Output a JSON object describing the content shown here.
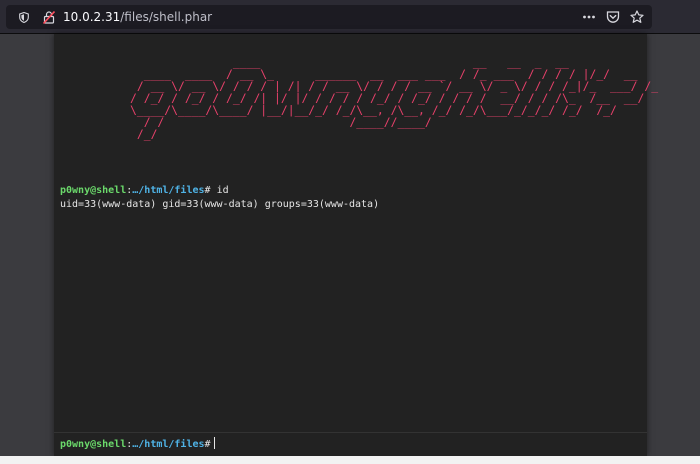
{
  "browser": {
    "url_host": "10.0.2.31",
    "url_path": "/files/shell.phar",
    "icons": [
      "shield-icon",
      "insecure-lock-icon",
      "more-dots-icon",
      "pocket-icon",
      "bookmark-star-icon"
    ]
  },
  "terminal": {
    "banner": "               ____                               __   __  _  __\n  ____  ____  / __ \\_      ______  __  ___ ___  / /_ ___  / / / / |/_/  __\n / __ \\/ __ \\/ / / / | /| / / __ \\/ / / / __ `/ __ \\/ _ \\/ / / /_|/_  ___/ /_\n/ /_/ / /_/ / /_/ /| |/ |/ / / / / /_/ / /_/ / / / /  __/ / / /\\_  /__  __/\n\\____/\\____/\\____/ |__/|__/_/ /_/\\__, /\\__, /_/ /_/\\___/_/_/_/ /_/  /_/\n  / /                           /____//____/\n /_/",
    "prompt_user": "p0wny@shell",
    "prompt_sep": ":",
    "prompt_path": "…/html/files",
    "prompt_hash": "#",
    "command": " id",
    "output": "uid=33(www-data) gid=33(www-data) groups=33(www-data)",
    "input_value": ""
  },
  "colors": {
    "banner": "#e8416b",
    "prompt_user": "#6bd96b",
    "prompt_path": "#4fb3e6",
    "terminal_bg": "#222222"
  }
}
